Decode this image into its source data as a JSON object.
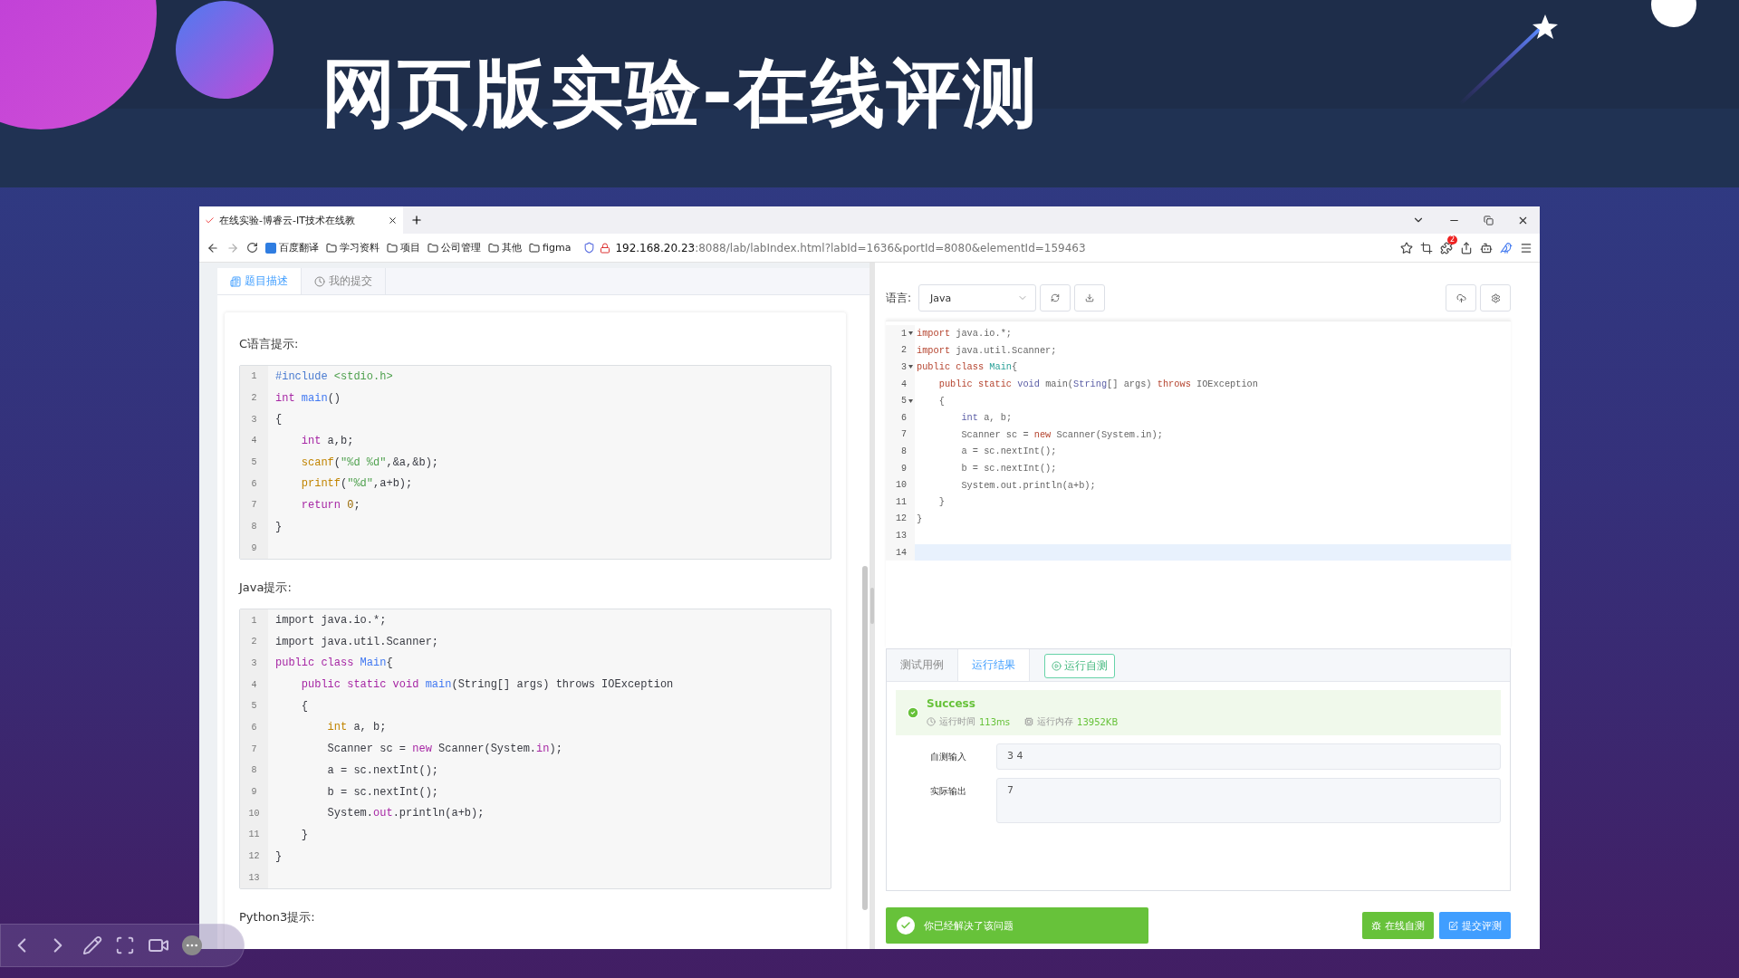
{
  "slide": {
    "title": "网页版实验-在线评测"
  },
  "browser": {
    "tab": {
      "title": "在线实验-博睿云-IT技术在线教"
    },
    "bookmarks": [
      {
        "label": "百度翻译",
        "kind": "app"
      },
      {
        "label": "学习资料",
        "kind": "folder"
      },
      {
        "label": "项目",
        "kind": "folder"
      },
      {
        "label": "公司管理",
        "kind": "folder"
      },
      {
        "label": "其他",
        "kind": "folder"
      },
      {
        "label": "figma",
        "kind": "folder"
      }
    ],
    "address": {
      "host": "192.168.20.23",
      "path": ":8088/lab/labIndex.html?labId=1636&portId=8080&elementId=159463"
    },
    "extension_badge": "2"
  },
  "problem_panel": {
    "tabs": [
      {
        "label": "题目描述",
        "selected": true
      },
      {
        "label": "我的提交",
        "selected": false
      }
    ],
    "sections": [
      {
        "heading": "C语言提示:",
        "code": [
          {
            "n": "1",
            "segs": [
              {
                "t": "#include ",
                "kind": "meta"
              },
              {
                "t": "<stdio.h>",
                "kind": "str"
              }
            ]
          },
          {
            "n": "2",
            "segs": [
              {
                "t": "int",
                "kind": "kw"
              },
              {
                "t": " main",
                "kind": "def"
              },
              {
                "t": "()",
                "kind": "p"
              }
            ]
          },
          {
            "n": "3",
            "segs": [
              {
                "t": "{",
                "kind": "p"
              }
            ]
          },
          {
            "n": "4",
            "segs": [
              {
                "t": "    int",
                "kind": "kw"
              },
              {
                "t": " a,b;",
                "kind": "p"
              }
            ]
          },
          {
            "n": "5",
            "segs": [
              {
                "t": "    scanf",
                "kind": "builtin"
              },
              {
                "t": "(",
                "kind": "p"
              },
              {
                "t": "\"%d %d\"",
                "kind": "str"
              },
              {
                "t": ",&a,&b);",
                "kind": "p"
              }
            ]
          },
          {
            "n": "6",
            "segs": [
              {
                "t": "    printf",
                "kind": "builtin"
              },
              {
                "t": "(",
                "kind": "p"
              },
              {
                "t": "\"%d\"",
                "kind": "str"
              },
              {
                "t": ",a+b);",
                "kind": "p"
              }
            ]
          },
          {
            "n": "7",
            "segs": [
              {
                "t": "    return",
                "kind": "kw"
              },
              {
                "t": " 0",
                "kind": "num"
              },
              {
                "t": ";",
                "kind": "p"
              }
            ]
          },
          {
            "n": "8",
            "segs": [
              {
                "t": "}",
                "kind": "p"
              }
            ]
          },
          {
            "n": "9"
          }
        ]
      },
      {
        "heading": "Java提示:",
        "code": [
          {
            "n": "1",
            "segs": [
              {
                "t": "import java.io.*;",
                "kind": "p"
              }
            ]
          },
          {
            "n": "2",
            "segs": [
              {
                "t": "import java.util.Scanner;",
                "kind": "p"
              }
            ]
          },
          {
            "n": "3",
            "segs": [
              {
                "t": "public class",
                "kind": "kw"
              },
              {
                "t": " Main",
                "kind": "def"
              },
              {
                "t": "{",
                "kind": "p"
              }
            ]
          },
          {
            "n": "4",
            "segs": [
              {
                "t": "    public static void",
                "kind": "kw"
              },
              {
                "t": " main",
                "kind": "def"
              },
              {
                "t": "(String[] args) throws IOException",
                "kind": "p"
              }
            ]
          },
          {
            "n": "5",
            "segs": [
              {
                "t": "    {",
                "kind": "p"
              }
            ]
          },
          {
            "n": "6",
            "segs": [
              {
                "t": "        int",
                "kind": "builtin"
              },
              {
                "t": " a, b;",
                "kind": "p"
              }
            ]
          },
          {
            "n": "7",
            "segs": [
              {
                "t": "        Scanner sc = ",
                "kind": "p"
              },
              {
                "t": "new",
                "kind": "kw"
              },
              {
                "t": " Scanner(System.",
                "kind": "p"
              },
              {
                "t": "in",
                "kind": "kw"
              },
              {
                "t": ");",
                "kind": "p"
              }
            ]
          },
          {
            "n": "8",
            "segs": [
              {
                "t": "        a = sc.nextInt();",
                "kind": "p"
              }
            ]
          },
          {
            "n": "9",
            "segs": [
              {
                "t": "        b = sc.nextInt();",
                "kind": "p"
              }
            ]
          },
          {
            "n": "10",
            "segs": [
              {
                "t": "        System.",
                "kind": "p"
              },
              {
                "t": "out",
                "kind": "kw"
              },
              {
                "t": ".println(a+b);",
                "kind": "p"
              }
            ]
          },
          {
            "n": "11",
            "segs": [
              {
                "t": "    }",
                "kind": "p"
              }
            ]
          },
          {
            "n": "12",
            "segs": [
              {
                "t": "}",
                "kind": "p"
              }
            ]
          },
          {
            "n": "13"
          }
        ]
      },
      {
        "heading": "Python3提示:"
      }
    ]
  },
  "editor_panel": {
    "language_label": "语言:",
    "language": "Java",
    "code": [
      {
        "n": "1",
        "fold": true,
        "active": false,
        "segs": [
          {
            "t": "import",
            "kind": "kw"
          },
          {
            "t": " java.io.*;",
            "kind": "p"
          }
        ]
      },
      {
        "n": "2",
        "fold": false,
        "active": false,
        "segs": [
          {
            "t": "import",
            "kind": "kw"
          },
          {
            "t": " java.util.Scanner;",
            "kind": "p"
          }
        ]
      },
      {
        "n": "3",
        "fold": true,
        "active": false,
        "segs": [
          {
            "t": "public class",
            "kind": "kw"
          },
          {
            "t": " Main",
            "kind": "cls"
          },
          {
            "t": "{",
            "kind": "p"
          }
        ]
      },
      {
        "n": "4",
        "fold": false,
        "active": false,
        "segs": [
          {
            "t": "    public static",
            "kind": "kw"
          },
          {
            "t": " void",
            "kind": "type"
          },
          {
            "t": " main(",
            "kind": "p"
          },
          {
            "t": "String",
            "kind": "type"
          },
          {
            "t": "[] args) ",
            "kind": "p"
          },
          {
            "t": "throws",
            "kind": "kw"
          },
          {
            "t": " IOException",
            "kind": "p"
          }
        ]
      },
      {
        "n": "5",
        "fold": true,
        "active": false,
        "segs": [
          {
            "t": "    {",
            "kind": "p"
          }
        ]
      },
      {
        "n": "6",
        "fold": false,
        "active": false,
        "segs": [
          {
            "t": "        int",
            "kind": "type"
          },
          {
            "t": " a, b;",
            "kind": "p"
          }
        ]
      },
      {
        "n": "7",
        "fold": false,
        "active": false,
        "segs": [
          {
            "t": "        Scanner sc = ",
            "kind": "p"
          },
          {
            "t": "new",
            "kind": "kw"
          },
          {
            "t": " Scanner(System.in);",
            "kind": "p"
          }
        ]
      },
      {
        "n": "8",
        "fold": false,
        "active": false,
        "segs": [
          {
            "t": "        a = sc.nextInt();",
            "kind": "p"
          }
        ]
      },
      {
        "n": "9",
        "fold": false,
        "active": false,
        "segs": [
          {
            "t": "        b = sc.nextInt();",
            "kind": "p"
          }
        ]
      },
      {
        "n": "10",
        "fold": false,
        "active": false,
        "segs": [
          {
            "t": "        System.out.println(a+b);",
            "kind": "p"
          }
        ]
      },
      {
        "n": "11",
        "fold": false,
        "active": false,
        "segs": [
          {
            "t": "    }",
            "kind": "p"
          }
        ]
      },
      {
        "n": "12",
        "fold": false,
        "active": false,
        "segs": [
          {
            "t": "}",
            "kind": "p"
          }
        ]
      },
      {
        "n": "13",
        "fold": false,
        "active": false
      },
      {
        "n": "14",
        "fold": false,
        "active": true
      }
    ]
  },
  "result_panel": {
    "tabs": [
      {
        "label": "测试用例",
        "selected": false
      },
      {
        "label": "运行结果",
        "selected": true
      }
    ],
    "run_button": "运行自测",
    "status": "Success",
    "time_label": "运行时间",
    "time": "113ms",
    "memory_label": "运行内存",
    "memory": "13952KB",
    "fields": [
      {
        "label": "自测输入",
        "value": "3 4",
        "kind": "single"
      },
      {
        "label": "实际输出",
        "value": "7",
        "kind": "multi"
      }
    ]
  },
  "footer": {
    "solved_message": "你已经解决了该问题",
    "buttons": [
      {
        "label": "在线自测",
        "kind": "test"
      },
      {
        "label": "提交评测",
        "kind": "submit"
      }
    ]
  }
}
